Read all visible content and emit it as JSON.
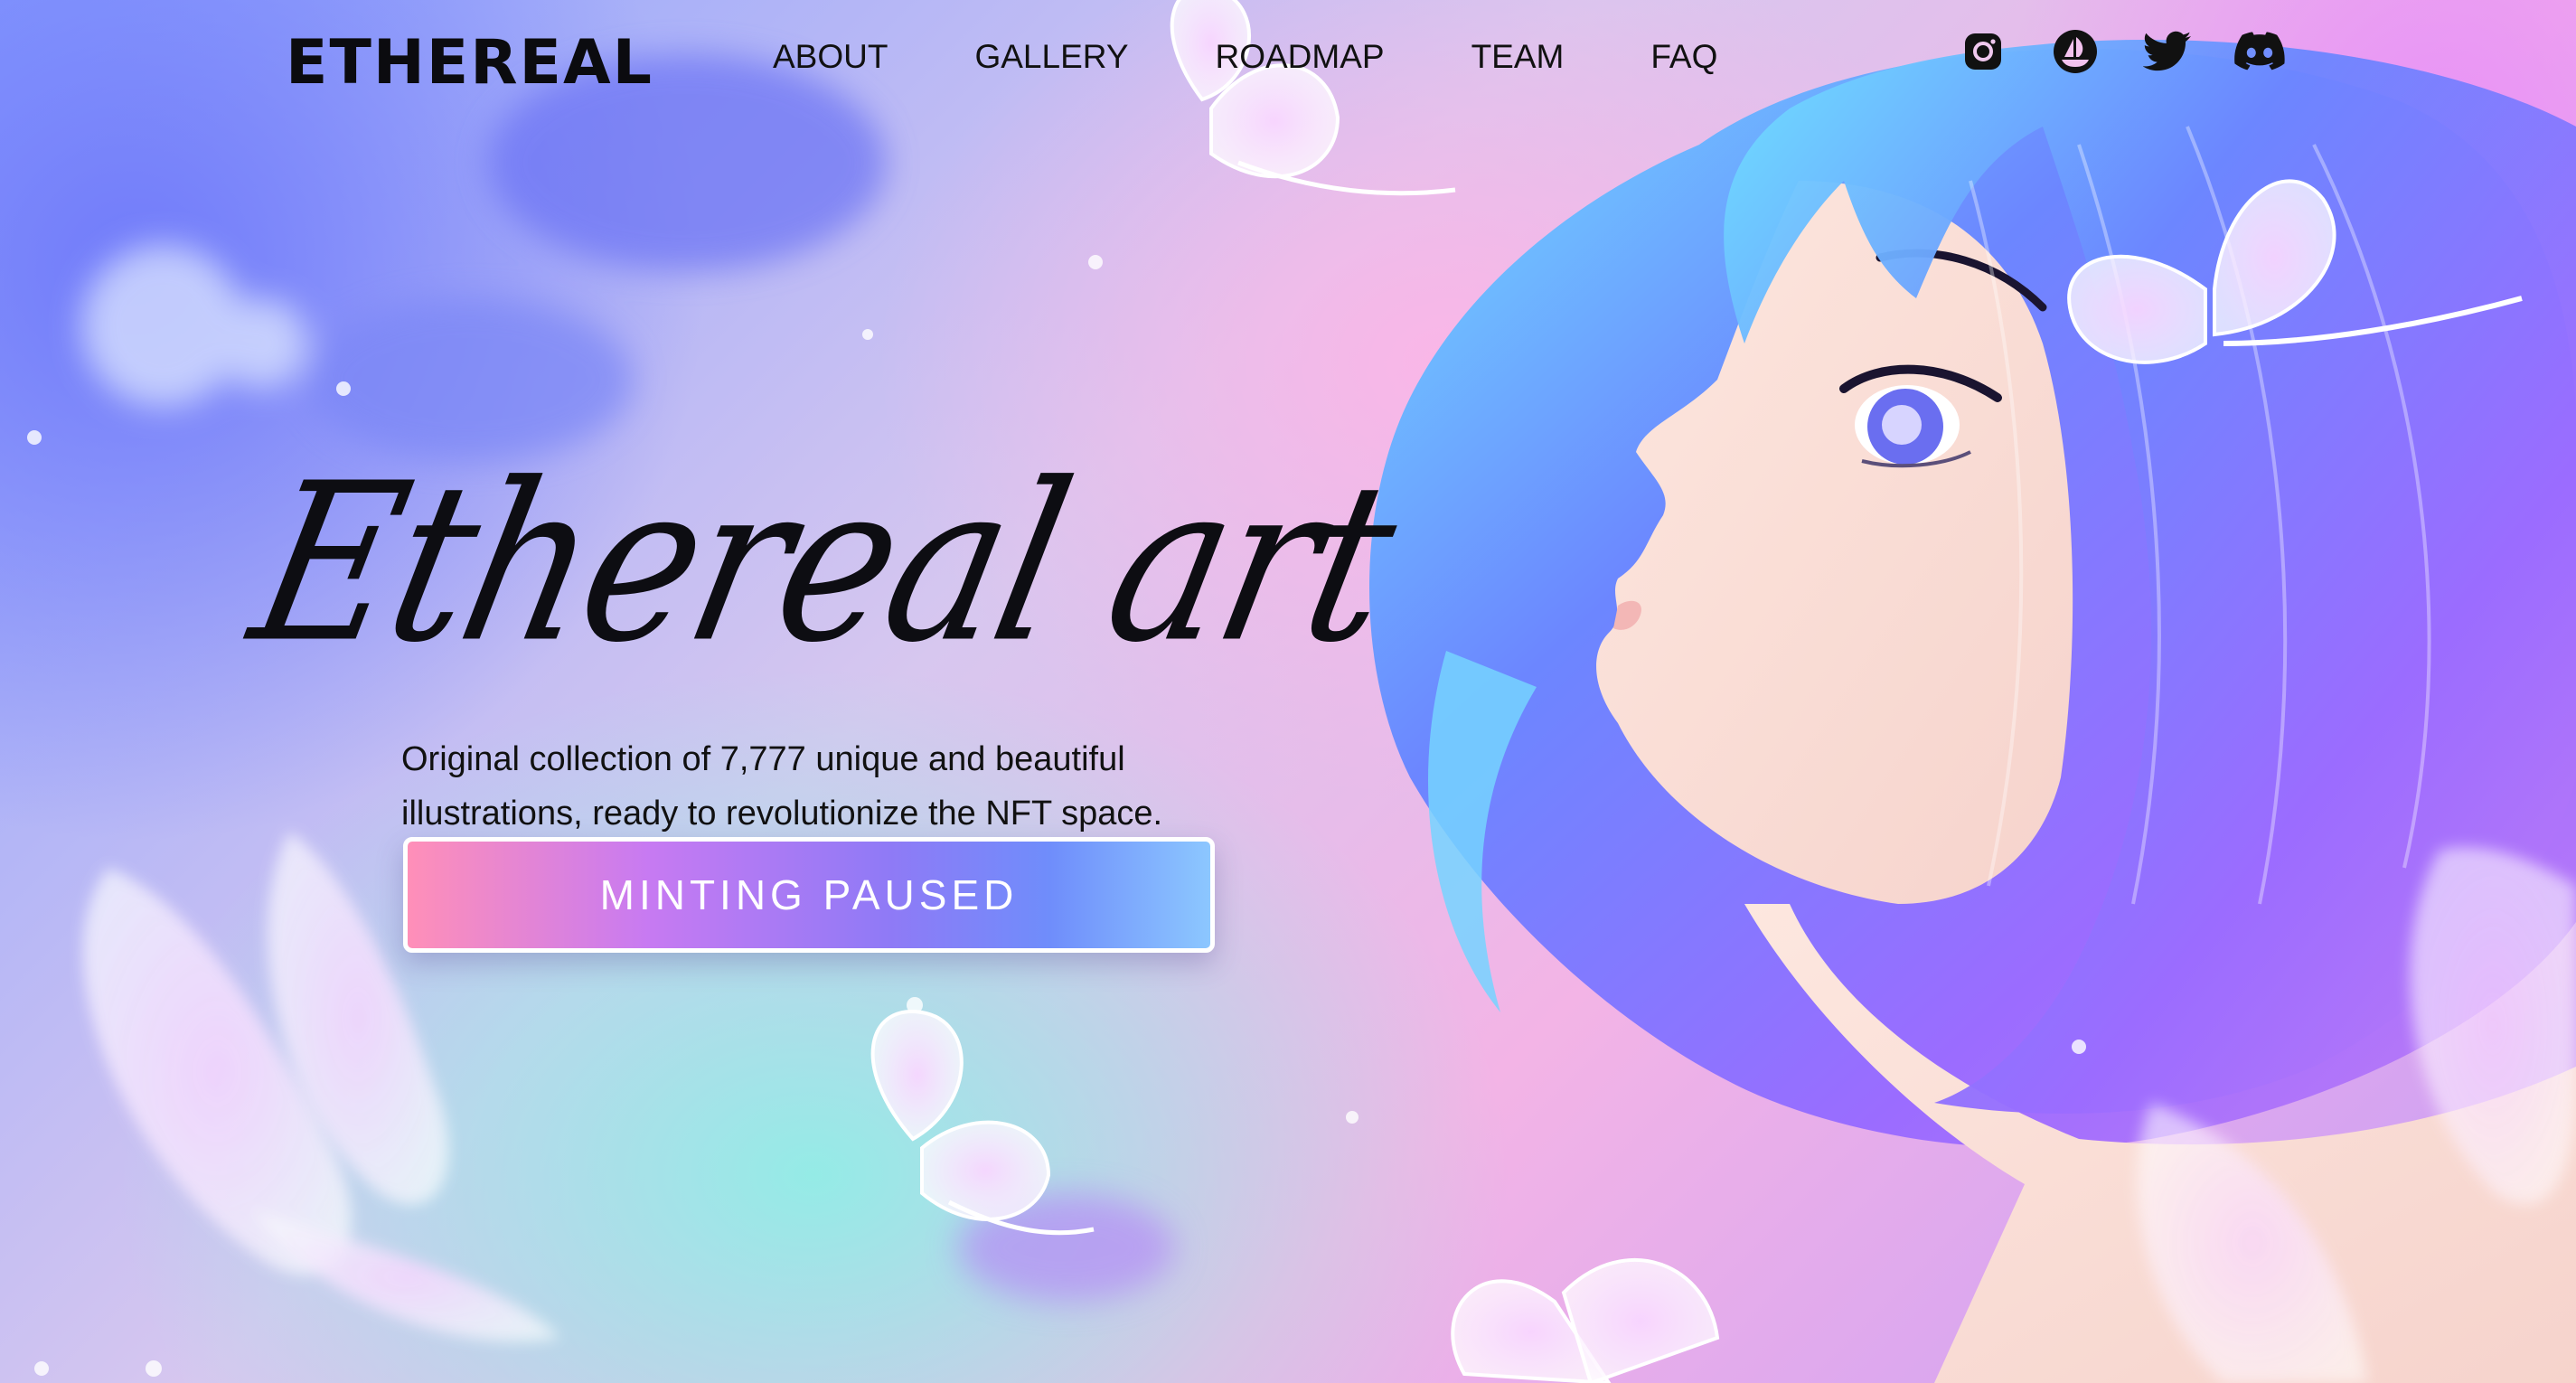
{
  "header": {
    "logo": "ETHEREAL",
    "nav": [
      {
        "label": "ABOUT"
      },
      {
        "label": "GALLERY"
      },
      {
        "label": "ROADMAP"
      },
      {
        "label": "TEAM"
      },
      {
        "label": "FAQ"
      }
    ],
    "socials": [
      {
        "icon": "instagram-icon"
      },
      {
        "icon": "opensea-icon"
      },
      {
        "icon": "twitter-icon"
      },
      {
        "icon": "discord-icon"
      }
    ]
  },
  "hero": {
    "title": "Ethereal art",
    "description": "Original collection of 7,777 unique and beautiful illustrations, ready to revolutionize the NFT space.",
    "button_label": "MINTING PAUSED"
  },
  "colors": {
    "button_gradient_start": "#ff8fb8",
    "button_gradient_mid": "#8f7af6",
    "button_gradient_end": "#8cc7ff",
    "text": "#111111"
  }
}
